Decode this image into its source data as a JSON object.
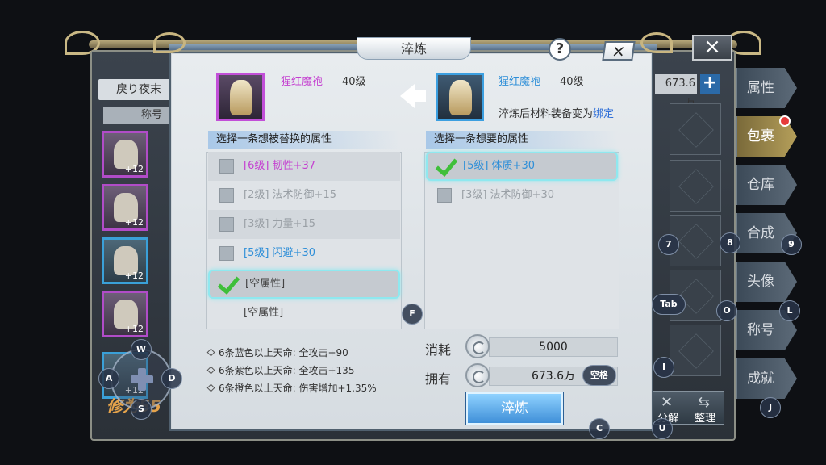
{
  "background": {
    "char_name": "戾り夜末",
    "title_label": "称号",
    "money": "673.6万",
    "item_counts": [
      "+12",
      "+12",
      "+12",
      "+12",
      "+12"
    ],
    "banner": "修为55",
    "buttons": {
      "decompose": "分解",
      "sort": "整理"
    },
    "tabs": [
      "属性",
      "包裹",
      "仓库",
      "合成",
      "头像",
      "称号",
      "成就"
    ]
  },
  "dialog": {
    "title": "淬炼",
    "help": "?",
    "close": "×",
    "left_item": {
      "name": "猩红魔袍",
      "level": "40级",
      "name_color": "#c43fd0"
    },
    "right_item": {
      "name": "猩红魔袍",
      "level": "40级",
      "name_color": "#2f8fd8",
      "note_prefix": "淬炼后材料装备变为",
      "note_bind": "绑定"
    },
    "left_section": "选择一条想被替换的属性",
    "right_section": "选择一条想要的属性",
    "left_attrs": [
      {
        "text": "[6级]  韧性+37",
        "color": "#c43fd0",
        "checked": false
      },
      {
        "text": "[2级]  法术防御+15",
        "color": "#9aa0a6",
        "checked": false
      },
      {
        "text": "[3级]  力量+15",
        "color": "#9aa0a6",
        "checked": false
      },
      {
        "text": "[5级]  闪避+30",
        "color": "#2f8fd8",
        "checked": false
      },
      {
        "text": "[空属性]",
        "color": "#444444",
        "checked": true
      },
      {
        "text": "[空属性]",
        "color": "#444444",
        "checked": false
      }
    ],
    "right_attrs": [
      {
        "text": "[5级]  体质+30",
        "color": "#2f8fd8",
        "checked": true
      },
      {
        "text": "[3级]  法术防御+30",
        "color": "#9aa0a6",
        "checked": false
      }
    ],
    "bonuses": [
      "6条蓝色以上天命: 全攻击+90",
      "6条紫色以上天命: 全攻击+135",
      "6条橙色以上天命: 伤害增加+1.35%"
    ],
    "cost_label": "消耗",
    "cost_value": "5000",
    "own_label": "拥有",
    "own_value": "673.6万",
    "confirm": "淬炼"
  },
  "keys": {
    "w": "W",
    "a": "A",
    "s": "S",
    "d": "D",
    "f": "F",
    "tab": "Tab",
    "space": "空格",
    "c": "C",
    "u": "U",
    "i": "I",
    "j": "J",
    "k7": "7",
    "k8": "8",
    "k9": "9",
    "o": "O",
    "l": "L"
  }
}
